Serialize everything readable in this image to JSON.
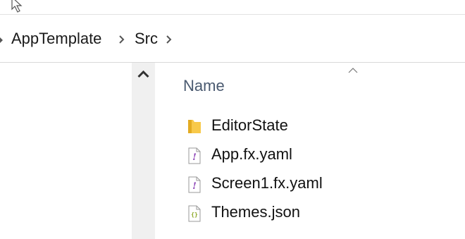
{
  "breadcrumb": {
    "items": [
      {
        "label": "AppTemplate"
      },
      {
        "label": "Src"
      }
    ]
  },
  "columns": {
    "name_header": "Name"
  },
  "files": [
    {
      "name": "EditorState",
      "icon": "folder-icon"
    },
    {
      "name": "App.fx.yaml",
      "icon": "yaml-file-icon"
    },
    {
      "name": "Screen1.fx.yaml",
      "icon": "yaml-file-icon"
    },
    {
      "name": "Themes.json",
      "icon": "json-file-icon"
    }
  ],
  "colors": {
    "folder": "#f8c94a",
    "yaml_accent": "#8a3fb5",
    "json_accent": "#8aa621",
    "header_text": "#4a5a70"
  }
}
